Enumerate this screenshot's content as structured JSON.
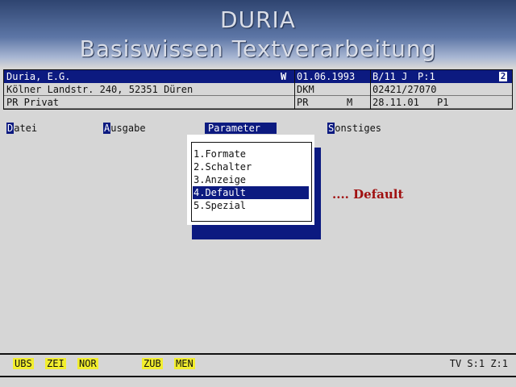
{
  "banner": {
    "title": "DURIA",
    "subtitle": "Basiswissen Textverarbeitung"
  },
  "header": {
    "row1": {
      "name": "Duria, E.G.",
      "flag": "W",
      "date": "01.06.1993",
      "age": "B/11 J",
      "page": "P:1",
      "indicator": "2"
    },
    "row2": {
      "address": "Kölner Landstr. 240, 52351 Düren",
      "code": "DKM",
      "phone": "02421/27070"
    },
    "row3": {
      "category": "PR Privat",
      "code": "PR",
      "sex": "M",
      "date": "28.11.01",
      "page": "P1"
    }
  },
  "menu": {
    "datei": {
      "key": "D",
      "rest": "atei"
    },
    "ausgabe": {
      "key": "A",
      "rest": "usgabe"
    },
    "parameter": {
      "label": "Parameter"
    },
    "sonstiges": {
      "key": "S",
      "rest": "onstiges"
    }
  },
  "dropdown": {
    "items": [
      {
        "label": "1.Formate"
      },
      {
        "label": "2.Schalter"
      },
      {
        "label": "3.Anzeige"
      },
      {
        "label": "4.Default"
      },
      {
        "label": "5.Spezial"
      }
    ],
    "selected_index": 3
  },
  "annotation": ".... Default",
  "statusbar": {
    "keys": [
      "UBS",
      "ZEI",
      "NOR",
      "ZUB",
      "MEN"
    ],
    "right": "TV S:1 Z:1"
  },
  "colors": {
    "highlight": "#0c1a80",
    "key_yellow": "#f2ee2e",
    "annotation_red": "#a01010"
  }
}
